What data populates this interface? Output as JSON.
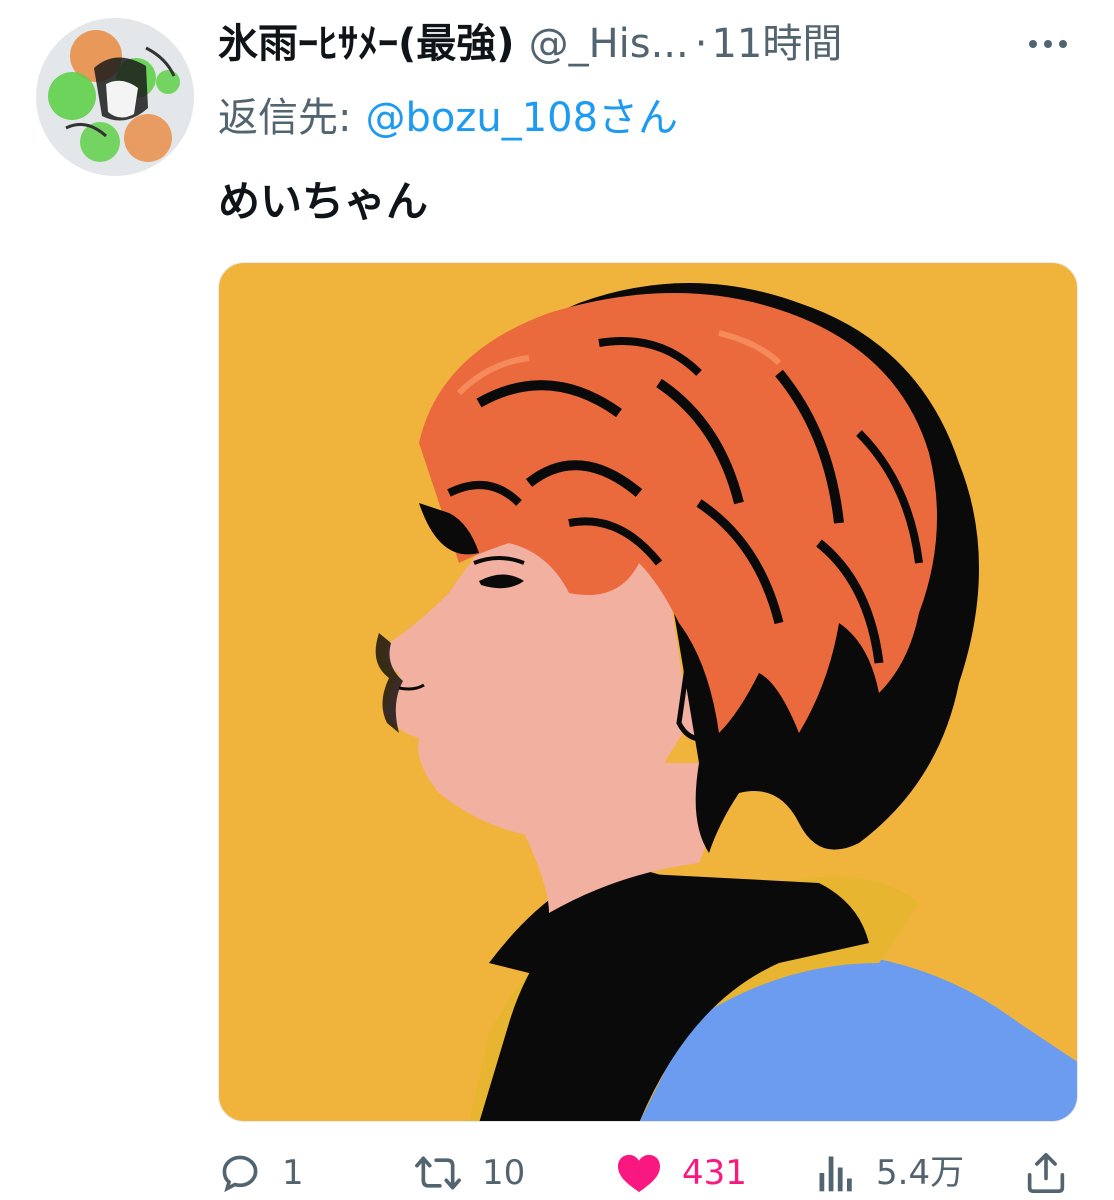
{
  "tweet": {
    "author": {
      "display_name": "氷雨ｰﾋｻﾒｰ(最強)",
      "handle": "@_His...",
      "avatar_icon": "user-avatar"
    },
    "separator": "·",
    "time": "11時間",
    "more_icon": "more-horizontal-icon",
    "reply": {
      "prefix": "返信先:",
      "target": "@bozu_108さん"
    },
    "text": "めいちゃん",
    "media": {
      "kind": "illustration",
      "colors": {
        "background": "#f0b43c",
        "hair": "#ea6a3e",
        "skin": "#f2b0a0",
        "jacket": "#6b9cf0",
        "collar": "#e8b530",
        "outline": "#0a0a0a"
      }
    },
    "actions": {
      "reply": {
        "icon": "reply-icon",
        "count": "1"
      },
      "retweet": {
        "icon": "retweet-icon",
        "count": "10"
      },
      "like": {
        "icon": "heart-icon",
        "count": "431",
        "liked": true
      },
      "views": {
        "icon": "views-icon",
        "count": "5.4万"
      },
      "share": {
        "icon": "share-icon"
      }
    },
    "colors": {
      "text_primary": "#0f1419",
      "text_secondary": "#536471",
      "link": "#1d9bf0",
      "like": "#f91880"
    }
  }
}
